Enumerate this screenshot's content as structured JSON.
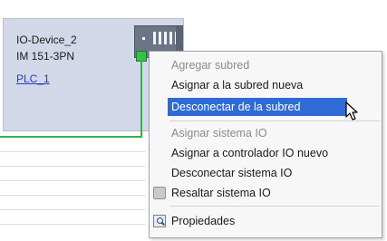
{
  "device": {
    "name": "IO-Device_2",
    "model": "IM 151-3PN",
    "controller_link": "PLC_1"
  },
  "context_menu": {
    "items": [
      {
        "label": "Agregar subred",
        "enabled": false,
        "icon": ""
      },
      {
        "label": "Asignar a la subred nueva",
        "enabled": true,
        "icon": ""
      },
      {
        "label": "Desconectar de la subred",
        "enabled": true,
        "highlighted": true,
        "icon": ""
      },
      {
        "label": "Asignar sistema IO",
        "enabled": false,
        "icon": ""
      },
      {
        "label": "Asignar a controlador IO nuevo",
        "enabled": true,
        "icon": ""
      },
      {
        "label": "Desconectar sistema IO",
        "enabled": true,
        "icon": ""
      },
      {
        "label": "Resaltar sistema IO",
        "enabled": true,
        "icon": "highlight-icon"
      },
      {
        "label": "Propiedades",
        "enabled": true,
        "icon": "properties-icon"
      }
    ]
  },
  "colors": {
    "device_background": "#d3d8e8",
    "connection_line": "#35b04a",
    "selection_highlight": "#2f6bd6"
  }
}
